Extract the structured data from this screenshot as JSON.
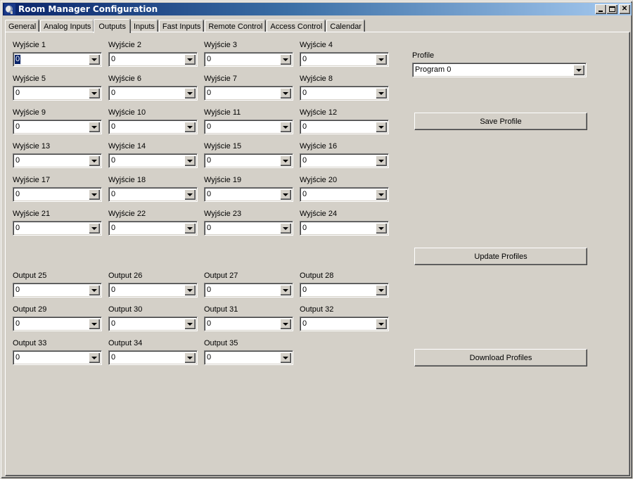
{
  "window": {
    "title": "Room Manager Configuration",
    "controls": [
      "minimize",
      "maximize",
      "close"
    ]
  },
  "tabs": [
    {
      "label": "General",
      "active": false
    },
    {
      "label": "Analog Inputs",
      "active": false
    },
    {
      "label": "Outputs",
      "active": true
    },
    {
      "label": "Inputs",
      "active": false
    },
    {
      "label": "Fast Inputs",
      "active": false
    },
    {
      "label": "Remote Control",
      "active": false
    },
    {
      "label": "Access Control",
      "active": false
    },
    {
      "label": "Calendar",
      "active": false
    }
  ],
  "outputs": [
    {
      "label": "Wyjście 1",
      "value": "0",
      "focused": true
    },
    {
      "label": "Wyjście 2",
      "value": "0"
    },
    {
      "label": "Wyjście 3",
      "value": "0"
    },
    {
      "label": "Wyjście 4",
      "value": "0"
    },
    {
      "label": "Wyjście 5",
      "value": "0"
    },
    {
      "label": "Wyjście 6",
      "value": "0"
    },
    {
      "label": "Wyjście 7",
      "value": "0"
    },
    {
      "label": "Wyjście 8",
      "value": "0"
    },
    {
      "label": "Wyjście 9",
      "value": "0"
    },
    {
      "label": "Wyjście 10",
      "value": "0"
    },
    {
      "label": "Wyjście 11",
      "value": "0"
    },
    {
      "label": "Wyjście 12",
      "value": "0"
    },
    {
      "label": "Wyjście 13",
      "value": "0"
    },
    {
      "label": "Wyjście 14",
      "value": "0"
    },
    {
      "label": "Wyjście 15",
      "value": "0"
    },
    {
      "label": "Wyjście 16",
      "value": "0"
    },
    {
      "label": "Wyjście 17",
      "value": "0"
    },
    {
      "label": "Wyjście 18",
      "value": "0"
    },
    {
      "label": "Wyjście 19",
      "value": "0"
    },
    {
      "label": "Wyjście 20",
      "value": "0"
    },
    {
      "label": "Wyjście 21",
      "value": "0"
    },
    {
      "label": "Wyjście 22",
      "value": "0"
    },
    {
      "label": "Wyjście 23",
      "value": "0"
    },
    {
      "label": "Wyjście 24",
      "value": "0"
    },
    {
      "label": "Output 25",
      "value": "0"
    },
    {
      "label": "Output 26",
      "value": "0"
    },
    {
      "label": "Output 27",
      "value": "0"
    },
    {
      "label": "Output 28",
      "value": "0"
    },
    {
      "label": "Output 29",
      "value": "0"
    },
    {
      "label": "Output 30",
      "value": "0"
    },
    {
      "label": "Output 31",
      "value": "0"
    },
    {
      "label": "Output 32",
      "value": "0"
    },
    {
      "label": "Output 33",
      "value": "0"
    },
    {
      "label": "Output 34",
      "value": "0"
    },
    {
      "label": "Output 35",
      "value": "0"
    }
  ],
  "profile": {
    "label": "Profile",
    "value": "Program 0"
  },
  "buttons": {
    "save": "Save Profile",
    "update": "Update Profiles",
    "download": "Download Profiles"
  }
}
